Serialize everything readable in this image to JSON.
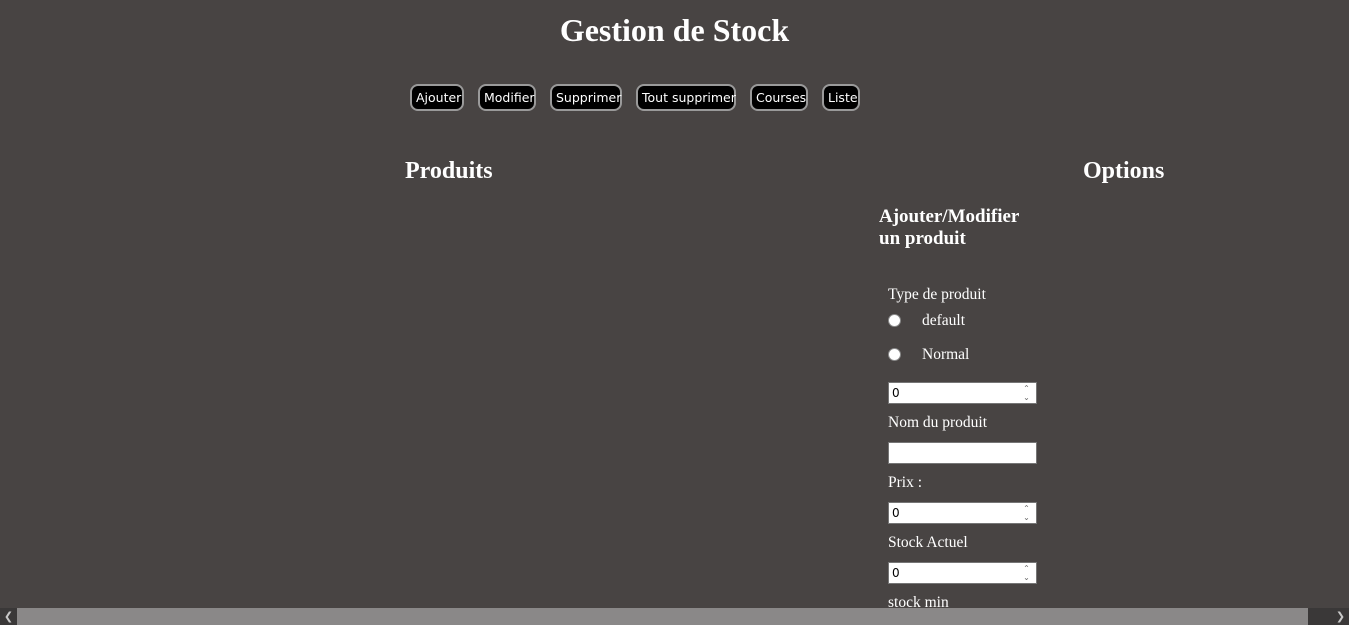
{
  "header": {
    "title": "Gestion de Stock"
  },
  "nav": {
    "buttons": [
      "Ajouter",
      "Modifier",
      "Supprimer",
      "Tout supprimer",
      "Courses",
      "Liste"
    ]
  },
  "sections": {
    "products_title": "Produits",
    "options_title": "Options"
  },
  "form": {
    "heading": "Ajouter/Modifier un produit",
    "type_label": "Type de produit",
    "type_options": [
      "default",
      "Normal"
    ],
    "type_number_value": "0",
    "name_label": "Nom du produit",
    "name_value": "",
    "price_label": "Prix :",
    "price_value": "0",
    "stock_label": "Stock Actuel",
    "stock_value": "0",
    "stock_min_label": "stock min"
  },
  "icons": {
    "spin_up": "chevron-up-icon",
    "spin_down": "chevron-down-icon",
    "scroll_left": "chevron-left-icon",
    "scroll_right": "chevron-right-icon"
  },
  "colors": {
    "background": "#484443",
    "button_bg": "#000000",
    "button_border": "#9a9a9a",
    "scrollbar_thumb": "#8a8888"
  }
}
